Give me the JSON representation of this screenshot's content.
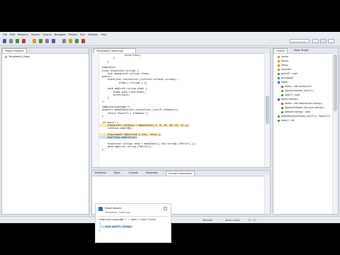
{
  "menu": [
    "File",
    "Edit",
    "Refactor",
    "Search",
    "Source",
    "Navigate",
    "Project",
    "Run",
    "Window",
    "Help"
  ],
  "toolbar": {
    "quick_access_placeholder": "Quick Access",
    "icon_colors": [
      "#3a5fa8",
      "#7a8796",
      "#4e8c3a",
      "#c0392b",
      "#d4a017",
      "#4e8c3a",
      "#8a6bbf",
      "#3a5fa8",
      "#7a8796",
      "#d4a017",
      "#4e8c3a",
      "#c0392b"
    ]
  },
  "project_explorer": {
    "tab_label": "Project Explorer",
    "items": [
      {
        "label": "Templates5_Video",
        "icon": "project-folder-icon"
      }
    ]
  },
  "editor": {
    "tab_label": "Templates5_Video.cpp",
    "lines": [
      {
        "text": "                  print(this);",
        "style": ""
      },
      {
        "text": "          }",
        "style": ""
      },
      {
        "text": "      }",
        "style": ""
      },
      {
        "text": "",
        "style": ""
      },
      {
        "text": "  template<>",
        "style": ""
      },
      {
        "text": "  class Stack<std::string> {",
        "style": ""
      },
      {
        "text": "      std::deque<std::string> elems;",
        "style": ""
      },
      {
        "text": "  public:",
        "style": ""
      },
      {
        "text": "      Stack(std::initializer_list<std::string> strings) :",
        "style": ""
      },
      {
        "text": "              elems { strings } {}",
        "style": ""
      },
      {
        "text": "",
        "style": ""
      },
      {
        "text": "      void add(std::string elem) {",
        "style": ""
      },
      {
        "text": "          elems.push_front(elem);",
        "style": ""
      },
      {
        "text": "          print(this);",
        "style": ""
      },
      {
        "text": "      }",
        "style": ""
      },
      {
        "text": "  };",
        "style": ""
      },
      {
        "text": "",
        "style": ""
      },
      {
        "text": "  template<typename T>",
        "style": ""
      },
      {
        "text": "  Stack<T> makeStack(std::initializer_list<T> elements){",
        "style": ""
      },
      {
        "text": "      return Stack<T> { elements };",
        "style": ""
      },
      {
        "text": "  }",
        "style": ""
      },
      {
        "text": "",
        "style": ""
      },
      {
        "text": "  int main() {",
        "style": ""
      },
      {
        "text": "      Stack<int> intStack = makeStack({ 4, 8, 15, 16, 23, 42 });",
        "style": "hl"
      },
      {
        "text": "      intStack.add(108);",
        "style": ""
      },
      {
        "text": "",
        "style": ""
      },
      {
        "text": "      Stack<bool> boolStack { true, false };",
        "style": "hl"
      },
      {
        "text": "      boolStack.add(false);",
        "style": "sel"
      },
      {
        "text": "",
        "style": ""
      },
      {
        "text": "      Stack<std::string> desk = makeStack({ std::string {\"Hello\"} });",
        "style": ""
      },
      {
        "text": "      desk.add(std::string {\"World\"});",
        "style": ""
      },
      {
        "text": "  }",
        "style": ""
      }
    ]
  },
  "outline": {
    "tabs": [
      "Outline",
      "Make Target"
    ],
    "items": [
      {
        "label": "vector",
        "icon": "include-icon",
        "color": "#c9a227",
        "indent": 0
      },
      {
        "label": "deque",
        "icon": "include-icon",
        "color": "#c9a227",
        "indent": 0
      },
      {
        "label": "string",
        "icon": "include-icon",
        "color": "#c9a227",
        "indent": 0
      },
      {
        "label": "iostream",
        "icon": "include-icon",
        "color": "#c9a227",
        "indent": 0
      },
      {
        "label": "print(T) : void",
        "icon": "function-icon",
        "color": "#2f8f3b",
        "indent": 0
      },
      {
        "label": "print(bool)",
        "icon": "function-icon",
        "color": "#2f8f3b",
        "indent": 0
      },
      {
        "label": "Stack",
        "icon": "class-icon",
        "color": "#2c6fb7",
        "indent": 0
      },
      {
        "label": "elems : std::vector<T>",
        "icon": "field-icon",
        "color": "#c0392b",
        "indent": 1
      },
      {
        "label": "Stack(initializer_list<T>)",
        "icon": "method-icon",
        "color": "#2f8f3b",
        "indent": 1
      },
      {
        "label": "add(T) : void",
        "icon": "method-icon",
        "color": "#2f8f3b",
        "indent": 1
      },
      {
        "label": "Stack<string>",
        "icon": "class-icon",
        "color": "#2c6fb7",
        "indent": 0
      },
      {
        "label": "elems : std::deque<std::string>",
        "icon": "field-icon",
        "color": "#c0392b",
        "indent": 1
      },
      {
        "label": "Stack(initializer_list<std::string>)",
        "icon": "method-icon",
        "color": "#2f8f3b",
        "indent": 1
      },
      {
        "label": "add(std::string) : void",
        "icon": "method-icon",
        "color": "#2f8f3b",
        "indent": 1
      },
      {
        "label": "makeStack(initializer_list<T>) : Stack<T>",
        "icon": "function-icon",
        "color": "#2f8f3b",
        "indent": 0
      },
      {
        "label": "main() : int",
        "icon": "function-icon",
        "color": "#2f8f3b",
        "indent": 0
      }
    ]
  },
  "bottom_panel": {
    "tabs": [
      "Problems",
      "Tasks",
      "Console",
      "Properties",
      "Include Information"
    ]
  },
  "status_bar": {
    "mode": "Writable",
    "insert": "Smart Insert",
    "position": "71 : 17"
  },
  "tooltip": {
    "title": "Stack<bool>",
    "location": "Templates5_Video.cpp",
    "lines": [
      "template<typename T = bool> class Stack",
      "{",
      "    void add(T) {elem};",
      "}"
    ]
  }
}
